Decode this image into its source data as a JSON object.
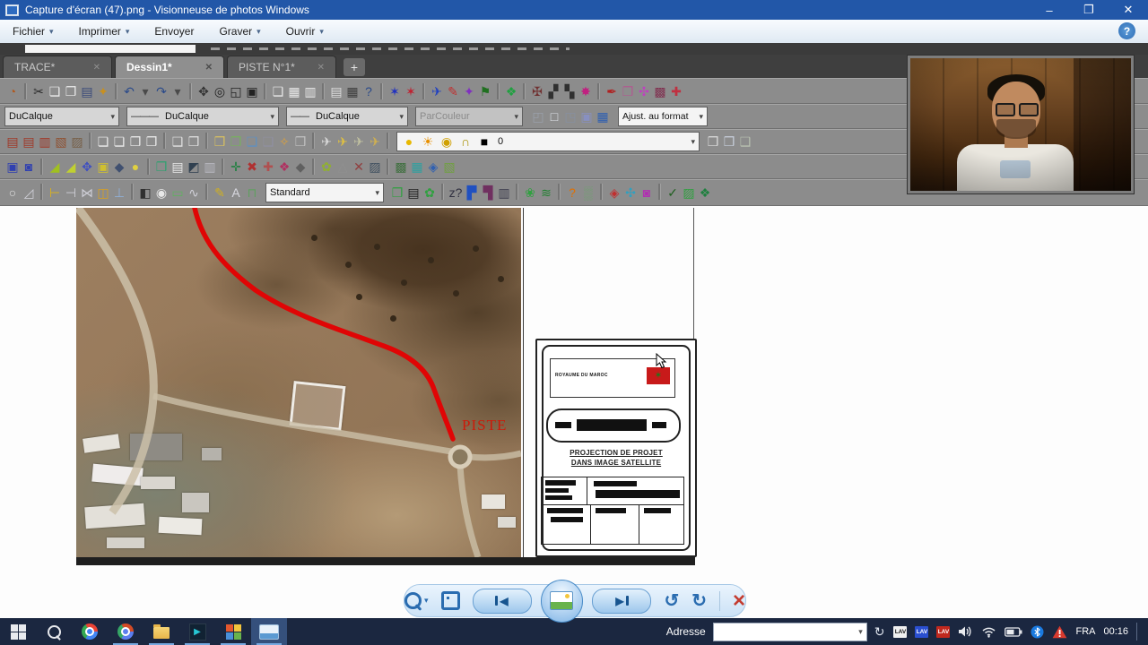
{
  "glyphs": {
    "chevron": "▾",
    "close": "✕",
    "plus": "+",
    "minimize": "–",
    "restore": "❐",
    "x_close": "✕",
    "help": "?",
    "line_long": "———",
    "line_short": "——",
    "left_tri": "◀",
    "right_tri": "▶",
    "rot_ccw": "↺",
    "rot_cw": "↻",
    "delete_x": "×",
    "refresh": "↻",
    "flag_star": "✶",
    "play": "▶"
  },
  "titlebar": {
    "title": "Capture d'écran (47).png - Visionneuse de photos Windows"
  },
  "menubar": {
    "items": [
      {
        "label": "Fichier"
      },
      {
        "label": "Imprimer"
      },
      {
        "label": "Envoyer"
      },
      {
        "label": "Graver"
      },
      {
        "label": "Ouvrir"
      }
    ]
  },
  "acad": {
    "tabs": [
      {
        "label": "TRACE*"
      },
      {
        "label": "Dessin1*"
      },
      {
        "label": "PISTE N°1*"
      }
    ],
    "dd": {
      "color": "DuCalque",
      "linetype": "DuCalque",
      "lineweight": "DuCalque",
      "plotstyle": "ParCouleur",
      "fit": "Ajust. au format",
      "layer_name": "0",
      "text_style": "Standard"
    },
    "toolbar1": [
      {
        "g": "◔",
        "c": "#b05a20"
      },
      {
        "sep": true
      },
      {
        "g": "✂",
        "c": "#2a2a2a"
      },
      {
        "g": "❏",
        "c": "#ececec"
      },
      {
        "g": "❐",
        "c": "#ececec"
      },
      {
        "g": "▤",
        "c": "#3a4a7a"
      },
      {
        "g": "✦",
        "c": "#c89020"
      },
      {
        "sep": true
      },
      {
        "g": "↶",
        "c": "#2a4a8a"
      },
      {
        "g": "▾",
        "c": "#4a4a4a"
      },
      {
        "g": "↷",
        "c": "#2a4a8a"
      },
      {
        "g": "▾",
        "c": "#4a4a4a"
      },
      {
        "sep": true
      },
      {
        "g": "✥",
        "c": "#333333"
      },
      {
        "g": "◎",
        "c": "#222222"
      },
      {
        "g": "◱",
        "c": "#222222"
      },
      {
        "g": "▣",
        "c": "#222222"
      },
      {
        "sep": true
      },
      {
        "g": "❑",
        "c": "#e8e8e8"
      },
      {
        "g": "▦",
        "c": "#e8e8e8"
      },
      {
        "g": "▥",
        "c": "#e8e8e8"
      },
      {
        "sep": true
      },
      {
        "g": "▤",
        "c": "#dddddd"
      },
      {
        "g": "▦",
        "c": "#3d3d3d"
      },
      {
        "g": "?",
        "c": "#2a4a8a"
      },
      {
        "sep": true
      },
      {
        "g": "✶",
        "c": "#2030c0"
      },
      {
        "g": "✶",
        "c": "#c02030"
      },
      {
        "sep": true
      },
      {
        "g": "✈",
        "c": "#2040c0"
      },
      {
        "g": "✎",
        "c": "#c03030"
      },
      {
        "g": "✦",
        "c": "#8030c0"
      },
      {
        "g": "⚑",
        "c": "#207020"
      },
      {
        "sep": true
      },
      {
        "g": "❖",
        "c": "#20a040"
      },
      {
        "sep": true
      },
      {
        "g": "✠",
        "c": "#703030"
      },
      {
        "g": "▞",
        "c": "#303030"
      },
      {
        "g": "▚",
        "c": "#303030"
      },
      {
        "g": "✸",
        "c": "#c02080"
      },
      {
        "sep": true
      },
      {
        "g": "✒",
        "c": "#b02020"
      },
      {
        "g": "❒",
        "c": "#b05a90"
      },
      {
        "g": "✣",
        "c": "#c040c0"
      },
      {
        "g": "▩",
        "c": "#803050"
      },
      {
        "g": "✚",
        "c": "#c03040"
      }
    ],
    "toolbar2_icons": [
      {
        "g": "◰",
        "c": "#9aa0aa"
      },
      {
        "g": "□",
        "c": "#e0e4ea"
      },
      {
        "g": "◳",
        "c": "#8890a0"
      },
      {
        "g": "▣",
        "c": "#8890c0"
      },
      {
        "g": "▦",
        "c": "#3060b0"
      }
    ],
    "toolbar3_left": [
      {
        "g": "▤",
        "c": "#a03828"
      },
      {
        "g": "▤",
        "c": "#a03828"
      },
      {
        "g": "▥",
        "c": "#a03828"
      },
      {
        "g": "▧",
        "c": "#905030"
      },
      {
        "g": "▨",
        "c": "#786048"
      },
      {
        "sep": true
      },
      {
        "g": "❏",
        "c": "#ececec"
      },
      {
        "g": "❏",
        "c": "#ececec"
      },
      {
        "g": "❐",
        "c": "#ececec"
      },
      {
        "g": "❐",
        "c": "#ececec"
      },
      {
        "sep": true
      },
      {
        "g": "❑",
        "c": "#e0e0e0"
      },
      {
        "g": "❒",
        "c": "#e0e0e0"
      },
      {
        "sep": true
      },
      {
        "g": "❒",
        "c": "#d8c060"
      },
      {
        "g": "❒",
        "c": "#78b060"
      },
      {
        "g": "❑",
        "c": "#6090c0"
      },
      {
        "g": "❑",
        "c": "#9090a0"
      },
      {
        "g": "✧",
        "c": "#d8a040"
      },
      {
        "g": "❒",
        "c": "#c0c0c0"
      },
      {
        "sep": true
      },
      {
        "g": "✈",
        "c": "#d8d8d8"
      },
      {
        "g": "✈",
        "c": "#e0c040"
      },
      {
        "g": "✈",
        "c": "#c0c0a0"
      },
      {
        "g": "✈",
        "c": "#d0b050"
      },
      {
        "sep": true
      }
    ],
    "toolbar3_right": [
      {
        "g": "❒",
        "c": "#dcdcdc"
      },
      {
        "g": "❒",
        "c": "#c8d0dc"
      },
      {
        "g": "❑",
        "c": "#b8c0b0"
      }
    ],
    "toolbar4": [
      {
        "g": "▣",
        "c": "#3040b0"
      },
      {
        "g": "◙",
        "c": "#3040b0"
      },
      {
        "sep": true
      },
      {
        "g": "◢",
        "c": "#a0c020"
      },
      {
        "g": "◢",
        "c": "#c0d030"
      },
      {
        "g": "✥",
        "c": "#4050c0"
      },
      {
        "g": "▣",
        "c": "#d0c030"
      },
      {
        "g": "◆",
        "c": "#405070"
      },
      {
        "g": "●",
        "c": "#e0d040"
      },
      {
        "sep": true
      },
      {
        "g": "❒",
        "c": "#30a070"
      },
      {
        "g": "▤",
        "c": "#e8e8e8"
      },
      {
        "g": "◩",
        "c": "#304050"
      },
      {
        "g": "▥",
        "c": "#b8b8c0"
      },
      {
        "sep": true
      },
      {
        "g": "✛",
        "c": "#208040"
      },
      {
        "g": "✖",
        "c": "#b03030"
      },
      {
        "g": "✚",
        "c": "#b05050"
      },
      {
        "g": "❖",
        "c": "#b03060"
      },
      {
        "g": "◆",
        "c": "#606060"
      },
      {
        "sep": true
      },
      {
        "g": "✿",
        "c": "#90b030"
      },
      {
        "g": "△",
        "c": "#909090"
      },
      {
        "g": "✕",
        "c": "#904040"
      },
      {
        "g": "▨",
        "c": "#405060"
      },
      {
        "sep": true
      },
      {
        "g": "▩",
        "c": "#407040"
      },
      {
        "g": "▦",
        "c": "#30a0a0"
      },
      {
        "g": "◈",
        "c": "#3060b0"
      },
      {
        "g": "▧",
        "c": "#70a040"
      }
    ],
    "toolbar5_left": [
      {
        "g": "○",
        "c": "#e0e0e0"
      },
      {
        "g": "◿",
        "c": "#d0d0d8"
      },
      {
        "sep": true
      },
      {
        "g": "⊢",
        "c": "#d8b020"
      },
      {
        "g": "⊣",
        "c": "#d0d0d8"
      },
      {
        "g": "⋈",
        "c": "#d0d0d8"
      },
      {
        "g": "◫",
        "c": "#d8a020"
      },
      {
        "g": "⊥",
        "c": "#90b0d8"
      },
      {
        "sep": true
      },
      {
        "g": "◧",
        "c": "#303030"
      },
      {
        "g": "◉",
        "c": "#e8e8e8"
      },
      {
        "g": "▭",
        "c": "#60b060"
      },
      {
        "g": "∿",
        "c": "#d0d0d8"
      },
      {
        "sep": true
      },
      {
        "g": "✎",
        "c": "#d0b020"
      },
      {
        "g": "A",
        "c": "#d8d8e0"
      },
      {
        "g": "⊓",
        "c": "#60a060"
      }
    ],
    "toolbar5_right": [
      {
        "g": "❒",
        "c": "#30a040"
      },
      {
        "g": "▤",
        "c": "#202020"
      },
      {
        "g": "✿",
        "c": "#30a040"
      },
      {
        "sep": true
      },
      {
        "g": "z?",
        "c": "#303040"
      },
      {
        "g": "▛",
        "c": "#2050c0"
      },
      {
        "g": "▜",
        "c": "#703060"
      },
      {
        "g": "▥",
        "c": "#404050"
      },
      {
        "sep": true
      },
      {
        "g": "❀",
        "c": "#30a040"
      },
      {
        "g": "≋",
        "c": "#208030"
      },
      {
        "sep": true
      },
      {
        "g": "?",
        "c": "#e07000"
      },
      {
        "g": "▒",
        "c": "#70a070"
      },
      {
        "sep": true
      },
      {
        "g": "◈",
        "c": "#c03030"
      },
      {
        "g": "✣",
        "c": "#30a0c0"
      },
      {
        "g": "◙",
        "c": "#b030b0"
      },
      {
        "sep": true
      },
      {
        "g": "✓",
        "c": "#206020"
      },
      {
        "g": "▨",
        "c": "#30a040"
      },
      {
        "g": "❖",
        "c": "#208040"
      }
    ],
    "layer_icons": [
      {
        "g": "●",
        "c": "#e8b800"
      },
      {
        "g": "☀",
        "c": "#e89000"
      },
      {
        "g": "◉",
        "c": "#d0a000"
      },
      {
        "g": "∩",
        "c": "#a89000"
      },
      {
        "g": "■",
        "c": "#000000"
      }
    ]
  },
  "drawing": {
    "piste": "PISTE",
    "cartouche": {
      "country": "ROYAUME DU MAROC",
      "title_line1": "PROJECTION DE PROJET",
      "title_line2": "DANS IMAGE SATELLITE"
    }
  },
  "taskbar": {
    "address_label": "Adresse",
    "lang": "FRA",
    "time": "00:16",
    "lav": [
      "LAV",
      "LAV",
      "LAV"
    ]
  },
  "colors": {
    "accent_blue": "#2257a8",
    "route_red": "#e00505",
    "flag_red": "#c81a1a",
    "taskbar_navy": "#1b2740"
  }
}
